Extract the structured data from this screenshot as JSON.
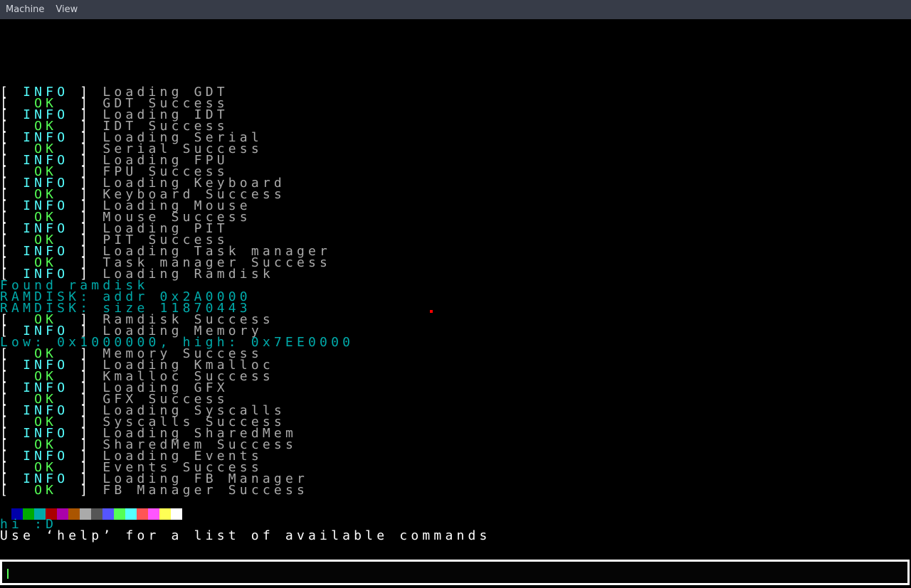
{
  "menubar": {
    "items": [
      "Machine",
      "View"
    ]
  },
  "log": [
    {
      "tag": "INFO",
      "msg": "Loading GDT"
    },
    {
      "tag": "OK",
      "msg": "GDT Success"
    },
    {
      "tag": "INFO",
      "msg": "Loading IDT"
    },
    {
      "tag": "OK",
      "msg": "IDT Success"
    },
    {
      "tag": "INFO",
      "msg": "Loading Serial"
    },
    {
      "tag": "OK",
      "msg": "Serial Success"
    },
    {
      "tag": "INFO",
      "msg": "Loading FPU"
    },
    {
      "tag": "OK",
      "msg": "FPU Success"
    },
    {
      "tag": "INFO",
      "msg": "Loading Keyboard"
    },
    {
      "tag": "OK",
      "msg": "Keyboard Success"
    },
    {
      "tag": "INFO",
      "msg": "Loading Mouse"
    },
    {
      "tag": "OK",
      "msg": "Mouse Success"
    },
    {
      "tag": "INFO",
      "msg": "Loading PIT"
    },
    {
      "tag": "OK",
      "msg": "PIT Success"
    },
    {
      "tag": "INFO",
      "msg": "Loading Task manager"
    },
    {
      "tag": "OK",
      "msg": "Task manager Success"
    },
    {
      "tag": "INFO",
      "msg": "Loading Ramdisk"
    },
    {
      "plain": "Found ramdisk"
    },
    {
      "plain": "RAMDISK: addr 0x2A0000"
    },
    {
      "plain": "RAMDISK: size 11870443"
    },
    {
      "tag": "OK",
      "msg": "Ramdisk Success"
    },
    {
      "tag": "INFO",
      "msg": "Loading Memory"
    },
    {
      "plain": "Low: 0x1000000, high: 0x7EE0000"
    },
    {
      "tag": "OK",
      "msg": "Memory Success"
    },
    {
      "tag": "INFO",
      "msg": "Loading Kmalloc"
    },
    {
      "tag": "OK",
      "msg": "Kmalloc Success"
    },
    {
      "tag": "INFO",
      "msg": "Loading GFX"
    },
    {
      "tag": "OK",
      "msg": "GFX Success"
    },
    {
      "tag": "INFO",
      "msg": "Loading Syscalls"
    },
    {
      "tag": "OK",
      "msg": "Syscalls Success"
    },
    {
      "tag": "INFO",
      "msg": "Loading SharedMem"
    },
    {
      "tag": "OK",
      "msg": "SharedMem Success"
    },
    {
      "tag": "INFO",
      "msg": "Loading Events"
    },
    {
      "tag": "OK",
      "msg": "Events Success"
    },
    {
      "tag": "INFO",
      "msg": "Loading FB Manager"
    },
    {
      "tag": "OK",
      "msg": "FB Manager Success"
    }
  ],
  "palette": [
    "#000000",
    "#0000aa",
    "#00aa00",
    "#00aaaa",
    "#aa0000",
    "#aa00aa",
    "#aa5500",
    "#aaaaaa",
    "#555555",
    "#5555ff",
    "#55ff55",
    "#55ffff",
    "#ff5555",
    "#ff55ff",
    "#ffff55",
    "#ffffff"
  ],
  "greeting": "hi :D",
  "help_hint": "Use ‘help’ for a list of available commands",
  "input": {
    "value": ""
  }
}
